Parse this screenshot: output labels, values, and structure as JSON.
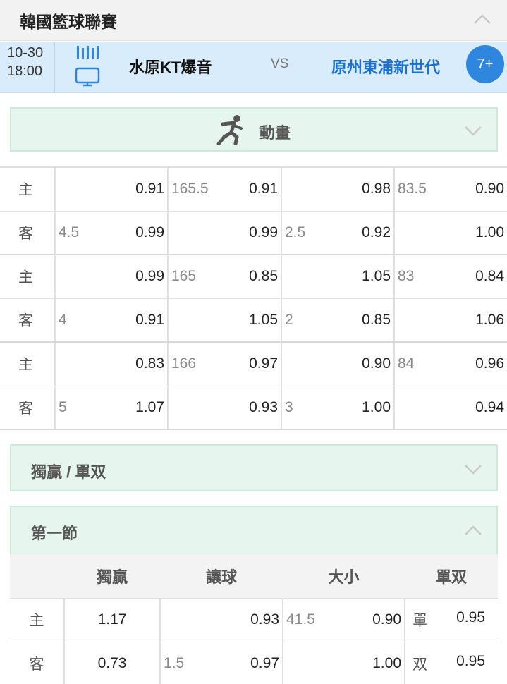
{
  "league": {
    "title": "韓國籃球聯賽"
  },
  "match": {
    "date": "10-30",
    "time": "18:00",
    "home": "水原KT爆音",
    "vs": "VS",
    "away": "原州東浦新世代",
    "more": "7+"
  },
  "sections": {
    "animation": "動畫",
    "winner_oddeven": "獨贏 / 單双",
    "first_quarter": "第一節"
  },
  "main_markets": [
    {
      "home": {
        "label": "主",
        "hcp": "",
        "hcp_odds": "0.91",
        "ou_line": "165.5",
        "ou_odds": "0.91",
        "half_hcp": "",
        "half_hcp_odds": "0.98",
        "half_ou_line": "83.5",
        "half_ou_odds": "0.90"
      },
      "away": {
        "label": "客",
        "hcp": "4.5",
        "hcp_odds": "0.99",
        "ou_line": "",
        "ou_odds": "0.99",
        "half_hcp": "2.5",
        "half_hcp_odds": "0.92",
        "half_ou_line": "",
        "half_ou_odds": "1.00"
      }
    },
    {
      "home": {
        "label": "主",
        "hcp": "",
        "hcp_odds": "0.99",
        "ou_line": "165",
        "ou_odds": "0.85",
        "half_hcp": "",
        "half_hcp_odds": "1.05",
        "half_ou_line": "83",
        "half_ou_odds": "0.84"
      },
      "away": {
        "label": "客",
        "hcp": "4",
        "hcp_odds": "0.91",
        "ou_line": "",
        "ou_odds": "1.05",
        "half_hcp": "2",
        "half_hcp_odds": "0.85",
        "half_ou_line": "",
        "half_ou_odds": "1.06"
      }
    },
    {
      "home": {
        "label": "主",
        "hcp": "",
        "hcp_odds": "0.83",
        "ou_line": "166",
        "ou_odds": "0.97",
        "half_hcp": "",
        "half_hcp_odds": "0.90",
        "half_ou_line": "84",
        "half_ou_odds": "0.96"
      },
      "away": {
        "label": "客",
        "hcp": "5",
        "hcp_odds": "1.07",
        "ou_line": "",
        "ou_odds": "0.93",
        "half_hcp": "3",
        "half_hcp_odds": "1.00",
        "half_ou_line": "",
        "half_ou_odds": "0.94"
      }
    }
  ],
  "q1": {
    "headers": [
      "獨贏",
      "讓球",
      "大小",
      "單双"
    ],
    "home": {
      "label": "主",
      "ml": "1.17",
      "hcp": "",
      "hcp_odds": "0.93",
      "ou_line": "41.5",
      "ou_odds": "0.90",
      "oe_label": "單",
      "oe_odds": "0.95"
    },
    "away": {
      "label": "客",
      "ml": "0.73",
      "hcp": "1.5",
      "hcp_odds": "0.97",
      "ou_line": "",
      "ou_odds": "1.00",
      "oe_label": "双",
      "oe_odds": "0.95"
    }
  }
}
